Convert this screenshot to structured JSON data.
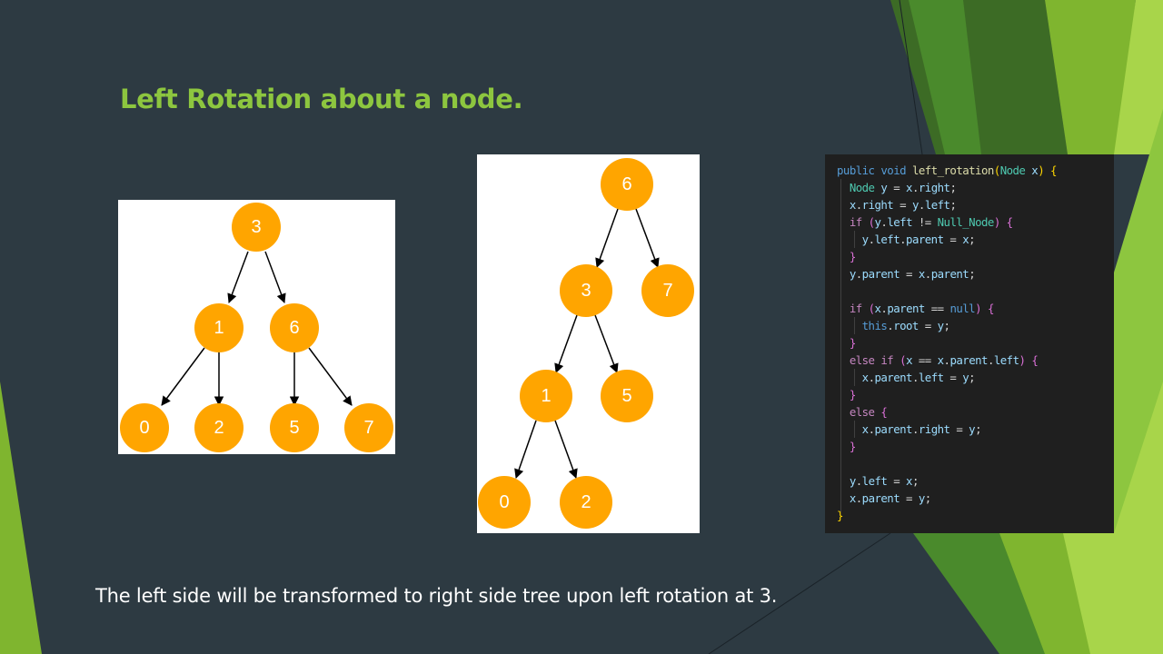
{
  "slide": {
    "title": "Left Rotation about a node.",
    "caption": "The left side will be transformed to right side tree upon left rotation at 3."
  },
  "colors": {
    "background": "#2d3a42",
    "title": "#8dc63f",
    "node": "#ffa500",
    "accent_green_dark": "#3f7a24",
    "accent_green_light": "#8dc63f"
  },
  "left_tree": {
    "nodes": [
      "3",
      "1",
      "6",
      "0",
      "2",
      "5",
      "7"
    ],
    "edges": [
      [
        "3",
        "1"
      ],
      [
        "3",
        "6"
      ],
      [
        "1",
        "0"
      ],
      [
        "1",
        "2"
      ],
      [
        "6",
        "5"
      ],
      [
        "6",
        "7"
      ]
    ]
  },
  "right_tree": {
    "nodes": [
      "6",
      "3",
      "7",
      "1",
      "5",
      "0",
      "2"
    ],
    "edges": [
      [
        "6",
        "3"
      ],
      [
        "6",
        "7"
      ],
      [
        "3",
        "1"
      ],
      [
        "3",
        "5"
      ],
      [
        "1",
        "0"
      ],
      [
        "1",
        "2"
      ]
    ]
  },
  "code": {
    "language": "java",
    "lines": [
      "public void left_rotation(Node x) {",
      "  Node y = x.right;",
      "  x.right = y.left;",
      "  if (y.left != Null_Node) {",
      "    y.left.parent = x;",
      "  }",
      "  y.parent = x.parent;",
      "",
      "  if (x.parent == null) {",
      "    this.root = y;",
      "  }",
      "  else if (x == x.parent.left) {",
      "    x.parent.left = y;",
      "  }",
      "  else {",
      "    x.parent.right = y;",
      "  }",
      "",
      "  y.left = x;",
      "  x.parent = y;",
      "}"
    ]
  }
}
